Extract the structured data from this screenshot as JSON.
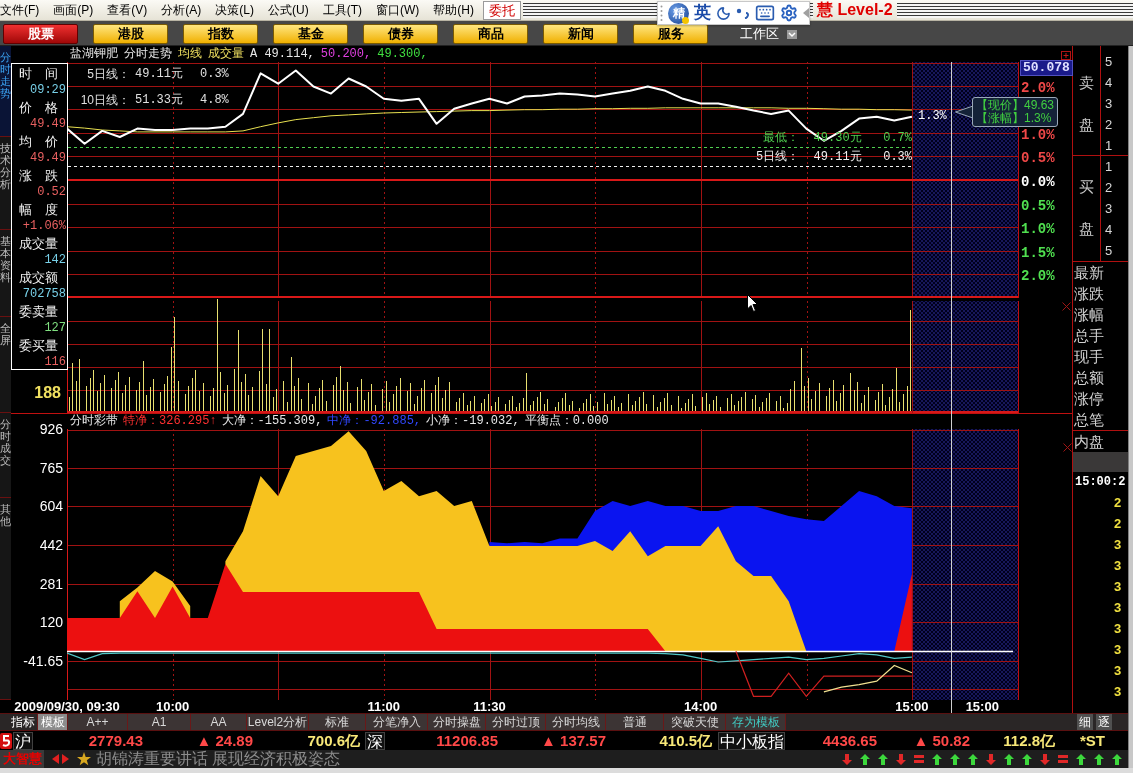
{
  "menu_bar": {
    "items": [
      "文件(F)",
      "画面(P)",
      "查看(V)",
      "分析(A)",
      "决策(L)",
      "公式(U)",
      "工具(T)",
      "窗口(W)",
      "帮助(H)"
    ],
    "trade_button": "委托",
    "brand": "慧 Level-2"
  },
  "ime_toolbar": {
    "logo": "精",
    "mode": "英"
  },
  "nav_buttons": [
    {
      "label": "股票",
      "selected": true
    },
    {
      "label": "港股",
      "selected": false
    },
    {
      "label": "指数",
      "selected": false
    },
    {
      "label": "基金",
      "selected": false
    },
    {
      "label": "债券",
      "selected": false
    },
    {
      "label": "商品",
      "selected": false
    },
    {
      "label": "新闻",
      "selected": false
    },
    {
      "label": "服务",
      "selected": false
    }
  ],
  "workspace": "工作区",
  "side_tabs": [
    {
      "label": "分时走势",
      "selected": true
    },
    {
      "label": "技术分析",
      "selected": false
    },
    {
      "label": "基本资料",
      "selected": false
    },
    {
      "label": "全屏",
      "selected": false
    }
  ],
  "lower_side_tabs": [
    {
      "label": "分时成交",
      "selected": false
    },
    {
      "label": "其他",
      "selected": false
    }
  ],
  "info_panel": [
    {
      "label": "时　间",
      "value": "09:29",
      "color": "#78d0e8"
    },
    {
      "label": "价　格",
      "value": "49.49",
      "color": "#e86060"
    },
    {
      "label": "均　价",
      "value": "49.49",
      "color": "#e86060"
    },
    {
      "label": "涨　跌",
      "value": "0.52",
      "color": "#e86060"
    },
    {
      "label": "幅　度",
      "value": "+1.06%",
      "color": "#e86060"
    },
    {
      "label": "成交量",
      "value": "142",
      "color": "#78d0e8"
    },
    {
      "label": "成交额",
      "value": "702758",
      "color": "#78d0e8"
    },
    {
      "label": "委卖量",
      "value": "127",
      "color": "#80e080"
    },
    {
      "label": "委买量",
      "value": "116",
      "color": "#e86060"
    }
  ],
  "price_chart": {
    "title": [
      {
        "text": "盐湖钾肥",
        "kind": "label"
      },
      {
        "text": "分时走势",
        "kind": "label"
      },
      {
        "text": "均线",
        "kind": "indicator"
      },
      {
        "text": "成交量",
        "kind": "indicator"
      },
      {
        "text": "A 49.114,",
        "kind": "price"
      },
      {
        "text": "50.200,",
        "kind": "high"
      },
      {
        "text": "49.300,",
        "kind": "low"
      }
    ],
    "legend": [
      {
        "label": "5日线：",
        "value": "49.11元",
        "pct": "0.3%"
      },
      {
        "label": "10日线：",
        "value": "51.33元",
        "pct": "4.8%"
      }
    ],
    "top_price": "50.078",
    "current_label": "1.3%",
    "tooltip": [
      "【现价】49.63",
      "【涨幅】1.3%"
    ],
    "chart_data": {
      "type": "line",
      "grid": true,
      "categories": [
        null,
        null,
        null,
        null,
        null,
        null,
        null,
        null,
        null,
        null,
        null,
        null,
        null,
        null,
        null,
        null,
        null,
        null,
        null,
        null,
        null,
        null,
        null,
        null,
        null,
        null,
        null,
        null,
        null,
        null,
        null,
        null,
        null,
        null,
        null,
        null,
        null,
        null,
        null,
        null,
        null,
        null,
        null,
        null,
        null,
        null,
        null,
        null,
        null
      ],
      "ylim": [
        -2.5,
        2.5
      ],
      "yticks": [
        {
          "value": 2,
          "label": "2.0%"
        },
        {
          "value": 1,
          "label": "1.0%"
        },
        {
          "value": 0.5,
          "label": "0.5%"
        },
        {
          "value": 0,
          "label": "0.0%"
        },
        {
          "value": -0.5,
          "label": "0.5%"
        },
        {
          "value": -1,
          "label": "1.0%"
        },
        {
          "value": -1.5,
          "label": "1.5%"
        },
        {
          "value": -2,
          "label": "2.0%"
        }
      ],
      "series": [
        {
          "color": "#ffffff",
          "values": [
            1.09,
            0.77,
            1.04,
            0.91,
            1.09,
            1.06,
            1.06,
            1.09,
            1.09,
            1.13,
            1.4,
            2.26,
            2.04,
            2.32,
            1.98,
            1.83,
            2.15,
            1.98,
            1.72,
            1.68,
            1.72,
            1.19,
            1.51,
            1.62,
            1.72,
            1.62,
            1.77,
            1.79,
            1.83,
            1.81,
            1.77,
            1.83,
            1.89,
            1.98,
            1.89,
            1.72,
            1.62,
            1.62,
            1.55,
            1.47,
            1.4,
            1.47,
            1.09,
            0.83,
            1.04,
            1.3,
            1.34,
            1.26,
            1.34
          ]
        },
        {
          "color": "#e8e050",
          "values": [
            1.13,
            1.1,
            1.06,
            1.04,
            1.02,
            1.02,
            1.02,
            1.02,
            1.02,
            1.02,
            1.04,
            1.13,
            1.21,
            1.28,
            1.32,
            1.36,
            1.38,
            1.4,
            1.42,
            1.43,
            1.44,
            1.45,
            1.46,
            1.47,
            1.47,
            1.48,
            1.49,
            1.49,
            1.5,
            1.5,
            1.51,
            1.51,
            1.52,
            1.52,
            1.53,
            1.53,
            1.53,
            1.53,
            1.53,
            1.53,
            1.53,
            1.52,
            1.52,
            1.51,
            1.5,
            1.5,
            1.49,
            1.49,
            1.48
          ]
        }
      ],
      "ref_lines": [
        {
          "axis": "y",
          "value": 0,
          "color": "#d81818"
        },
        {
          "axis": "y",
          "value": 0.7,
          "label": "最低：  49.30元   0.7%",
          "color": "#50d050"
        },
        {
          "axis": "y",
          "value": 0.3,
          "label": "5日线：  49.11元   0.3%",
          "color": "#f0f0f0"
        }
      ]
    }
  },
  "volume_chart": {
    "axis_label": "188"
  },
  "band_chart": {
    "header": [
      {
        "text": "分时彩带",
        "kind": "label"
      },
      {
        "text": "特净：326.295↑",
        "kind": "super"
      },
      {
        "text": "大净：-155.309,",
        "kind": "large"
      },
      {
        "text": "中净：-92.885,",
        "kind": "medium"
      },
      {
        "text": "小净：-19.032,",
        "kind": "small"
      },
      {
        "text": "平衡点：0.000",
        "kind": "balance"
      }
    ],
    "chart_data": {
      "type": "area",
      "grid": true,
      "categories": [
        "2009/09/30, 09:30",
        null,
        null,
        null,
        null,
        null,
        "10:00",
        null,
        null,
        null,
        null,
        null,
        null,
        null,
        null,
        null,
        null,
        null,
        "11:00",
        null,
        null,
        null,
        null,
        null,
        "11:30",
        null,
        null,
        null,
        null,
        null,
        null,
        null,
        null,
        null,
        null,
        null,
        "14:00",
        null,
        null,
        null,
        null,
        null,
        null,
        null,
        null,
        null,
        null,
        null,
        "15:00",
        null,
        null,
        null,
        "15:00",
        null
      ],
      "ylim": [
        -203.6,
        926
      ],
      "yticks": [
        {
          "value": 926,
          "label": "926"
        },
        {
          "value": 765,
          "label": "765"
        },
        {
          "value": 604,
          "label": "604"
        },
        {
          "value": 442,
          "label": "442"
        },
        {
          "value": 281,
          "label": "281"
        },
        {
          "value": 120,
          "label": "120"
        },
        {
          "value": -41.65,
          "label": "-41.65"
        }
      ],
      "series": [
        {
          "color": "#0a14f0",
          "values": [
            null,
            null,
            null,
            null,
            null,
            null,
            null,
            null,
            null,
            null,
            null,
            null,
            null,
            null,
            null,
            null,
            null,
            null,
            null,
            null,
            null,
            null,
            null,
            null,
            455,
            450,
            455,
            450,
            470,
            470,
            584,
            626,
            605,
            626,
            605,
            605,
            584,
            584,
            605,
            605,
            584,
            563,
            550,
            542,
            605,
            667,
            646,
            605,
            596,
            null,
            null,
            null,
            null,
            null
          ]
        },
        {
          "color": "#f7c21e",
          "values": [
            null,
            null,
            null,
            208,
            265,
            334,
            290,
            188,
            null,
            375,
            500,
            730,
            646,
            813,
            834,
            855,
            917,
            834,
            667,
            709,
            646,
            667,
            605,
            626,
            438,
            438,
            438,
            438,
            438,
            438,
            459,
            417,
            500,
            396,
            438,
            438,
            438,
            521,
            375,
            313,
            313,
            208,
            0,
            0,
            0,
            0,
            0,
            0,
            0,
            null,
            null,
            null,
            null,
            null
          ]
        },
        {
          "color": "#ec1010",
          "values": [
            138,
            138,
            138,
            138,
            250,
            138,
            270,
            138,
            138,
            363,
            246,
            246,
            246,
            246,
            246,
            246,
            246,
            246,
            246,
            246,
            246,
            92,
            92,
            92,
            92,
            92,
            92,
            92,
            92,
            92,
            92,
            92,
            92,
            92,
            0,
            0,
            0,
            0,
            0,
            0,
            0,
            0,
            0,
            0,
            0,
            0,
            0,
            0,
            321,
            null,
            null,
            null,
            null,
            null
          ]
        },
        {
          "type": "line",
          "color": "#50c8c8",
          "values": [
            -8,
            -35,
            -10,
            -8,
            -8,
            -8,
            -8,
            -8,
            -8,
            -8,
            -8,
            -8,
            -8,
            -8,
            -8,
            -8,
            -8,
            -8,
            -8,
            -8,
            -8,
            -8,
            -8,
            -8,
            -8,
            -8,
            -8,
            -8,
            -8,
            -8,
            -8,
            -8,
            -8,
            -8,
            -10,
            -15,
            -30,
            -45,
            -40,
            -35,
            -30,
            -25,
            -35,
            -30,
            -20,
            -10,
            -15,
            -30,
            -25,
            null,
            null,
            null,
            null,
            null
          ]
        },
        {
          "type": "line",
          "color": "#d02020",
          "values": [
            null,
            null,
            null,
            null,
            null,
            null,
            null,
            null,
            null,
            null,
            null,
            null,
            null,
            null,
            null,
            null,
            null,
            null,
            null,
            null,
            null,
            null,
            null,
            null,
            null,
            null,
            null,
            null,
            null,
            null,
            null,
            null,
            null,
            null,
            null,
            null,
            null,
            null,
            0,
            -188,
            -188,
            -92,
            -188,
            -104,
            -104,
            -104,
            -104,
            -104,
            -104,
            null,
            null,
            null,
            null,
            null
          ]
        },
        {
          "type": "line",
          "color": "#f0e090",
          "values": [
            null,
            null,
            null,
            null,
            null,
            null,
            null,
            null,
            null,
            null,
            null,
            null,
            null,
            null,
            null,
            null,
            null,
            null,
            null,
            null,
            null,
            null,
            null,
            null,
            null,
            null,
            null,
            null,
            null,
            null,
            null,
            null,
            null,
            null,
            null,
            null,
            null,
            null,
            null,
            null,
            null,
            null,
            null,
            -170,
            -150,
            -140,
            -125,
            -60,
            -90,
            null,
            null,
            null,
            null,
            null
          ]
        }
      ]
    }
  },
  "quote_panel": {
    "ask_label": "卖盘",
    "ask_levels": [
      "5",
      "4",
      "3",
      "2",
      "1"
    ],
    "bid_label": "买盘",
    "bid_levels": [
      "1",
      "2",
      "3",
      "4",
      "5"
    ],
    "fields": [
      "最新",
      "涨跌",
      "涨幅",
      "总手",
      "现手",
      "总额",
      "涨停",
      "总笔",
      "内盘"
    ],
    "tick_time": "15:00:2",
    "tick_values": [
      "2",
      "2",
      "3",
      "3",
      "3",
      "3",
      "3",
      "3",
      "3",
      "3"
    ]
  },
  "bottom_tabs": [
    {
      "label": "指标",
      "kind": "label",
      "selected": false
    },
    {
      "label": "模板",
      "kind": "tab",
      "selected": true
    },
    {
      "label": "A++",
      "kind": "tab",
      "selected": false
    },
    {
      "label": "A1",
      "kind": "tab",
      "selected": false
    },
    {
      "label": "AA",
      "kind": "tab",
      "selected": false
    },
    {
      "label": "Level2分析",
      "kind": "tab",
      "selected": false
    },
    {
      "label": "标准",
      "kind": "tab",
      "selected": false
    },
    {
      "label": "分笔净入",
      "kind": "tab",
      "selected": false
    },
    {
      "label": "分时操盘",
      "kind": "tab",
      "selected": false
    },
    {
      "label": "分时过顶",
      "kind": "tab",
      "selected": false
    },
    {
      "label": "分时均线",
      "kind": "tab",
      "selected": false
    },
    {
      "label": "普通",
      "kind": "tab",
      "selected": false
    },
    {
      "label": "突破天使",
      "kind": "tab",
      "selected": false
    },
    {
      "label": "存为模板",
      "kind": "action",
      "selected": false
    }
  ],
  "bottom_right_tabs": [
    "细",
    "逐"
  ],
  "index_bar": [
    {
      "name": "沪",
      "value": "2779.43",
      "change": "▲ 24.89",
      "amount": "700.6亿"
    },
    {
      "name": "深",
      "value": "11206.85",
      "change": "▲ 137.57",
      "amount": "410.5亿"
    },
    {
      "name": "中小板指",
      "value": "4436.65",
      "change": "▲ 50.82",
      "amount": "112.8亿"
    }
  ],
  "index_tail": "*ST",
  "news_bar": {
    "brand": "大智慧",
    "headline": "胡锦涛重要讲话 展现经济积极姿态"
  },
  "signals": [
    {
      "kind": "down"
    },
    {
      "kind": "up"
    },
    {
      "kind": "up"
    },
    {
      "kind": "down"
    },
    {
      "kind": "flat"
    },
    {
      "kind": "up"
    },
    {
      "kind": "up"
    },
    {
      "kind": "up"
    },
    {
      "kind": "down"
    },
    {
      "kind": "up"
    },
    {
      "kind": "up"
    },
    {
      "kind": "down"
    },
    {
      "kind": "flat"
    },
    {
      "kind": "up"
    },
    {
      "kind": "up"
    },
    {
      "kind": "up"
    }
  ]
}
